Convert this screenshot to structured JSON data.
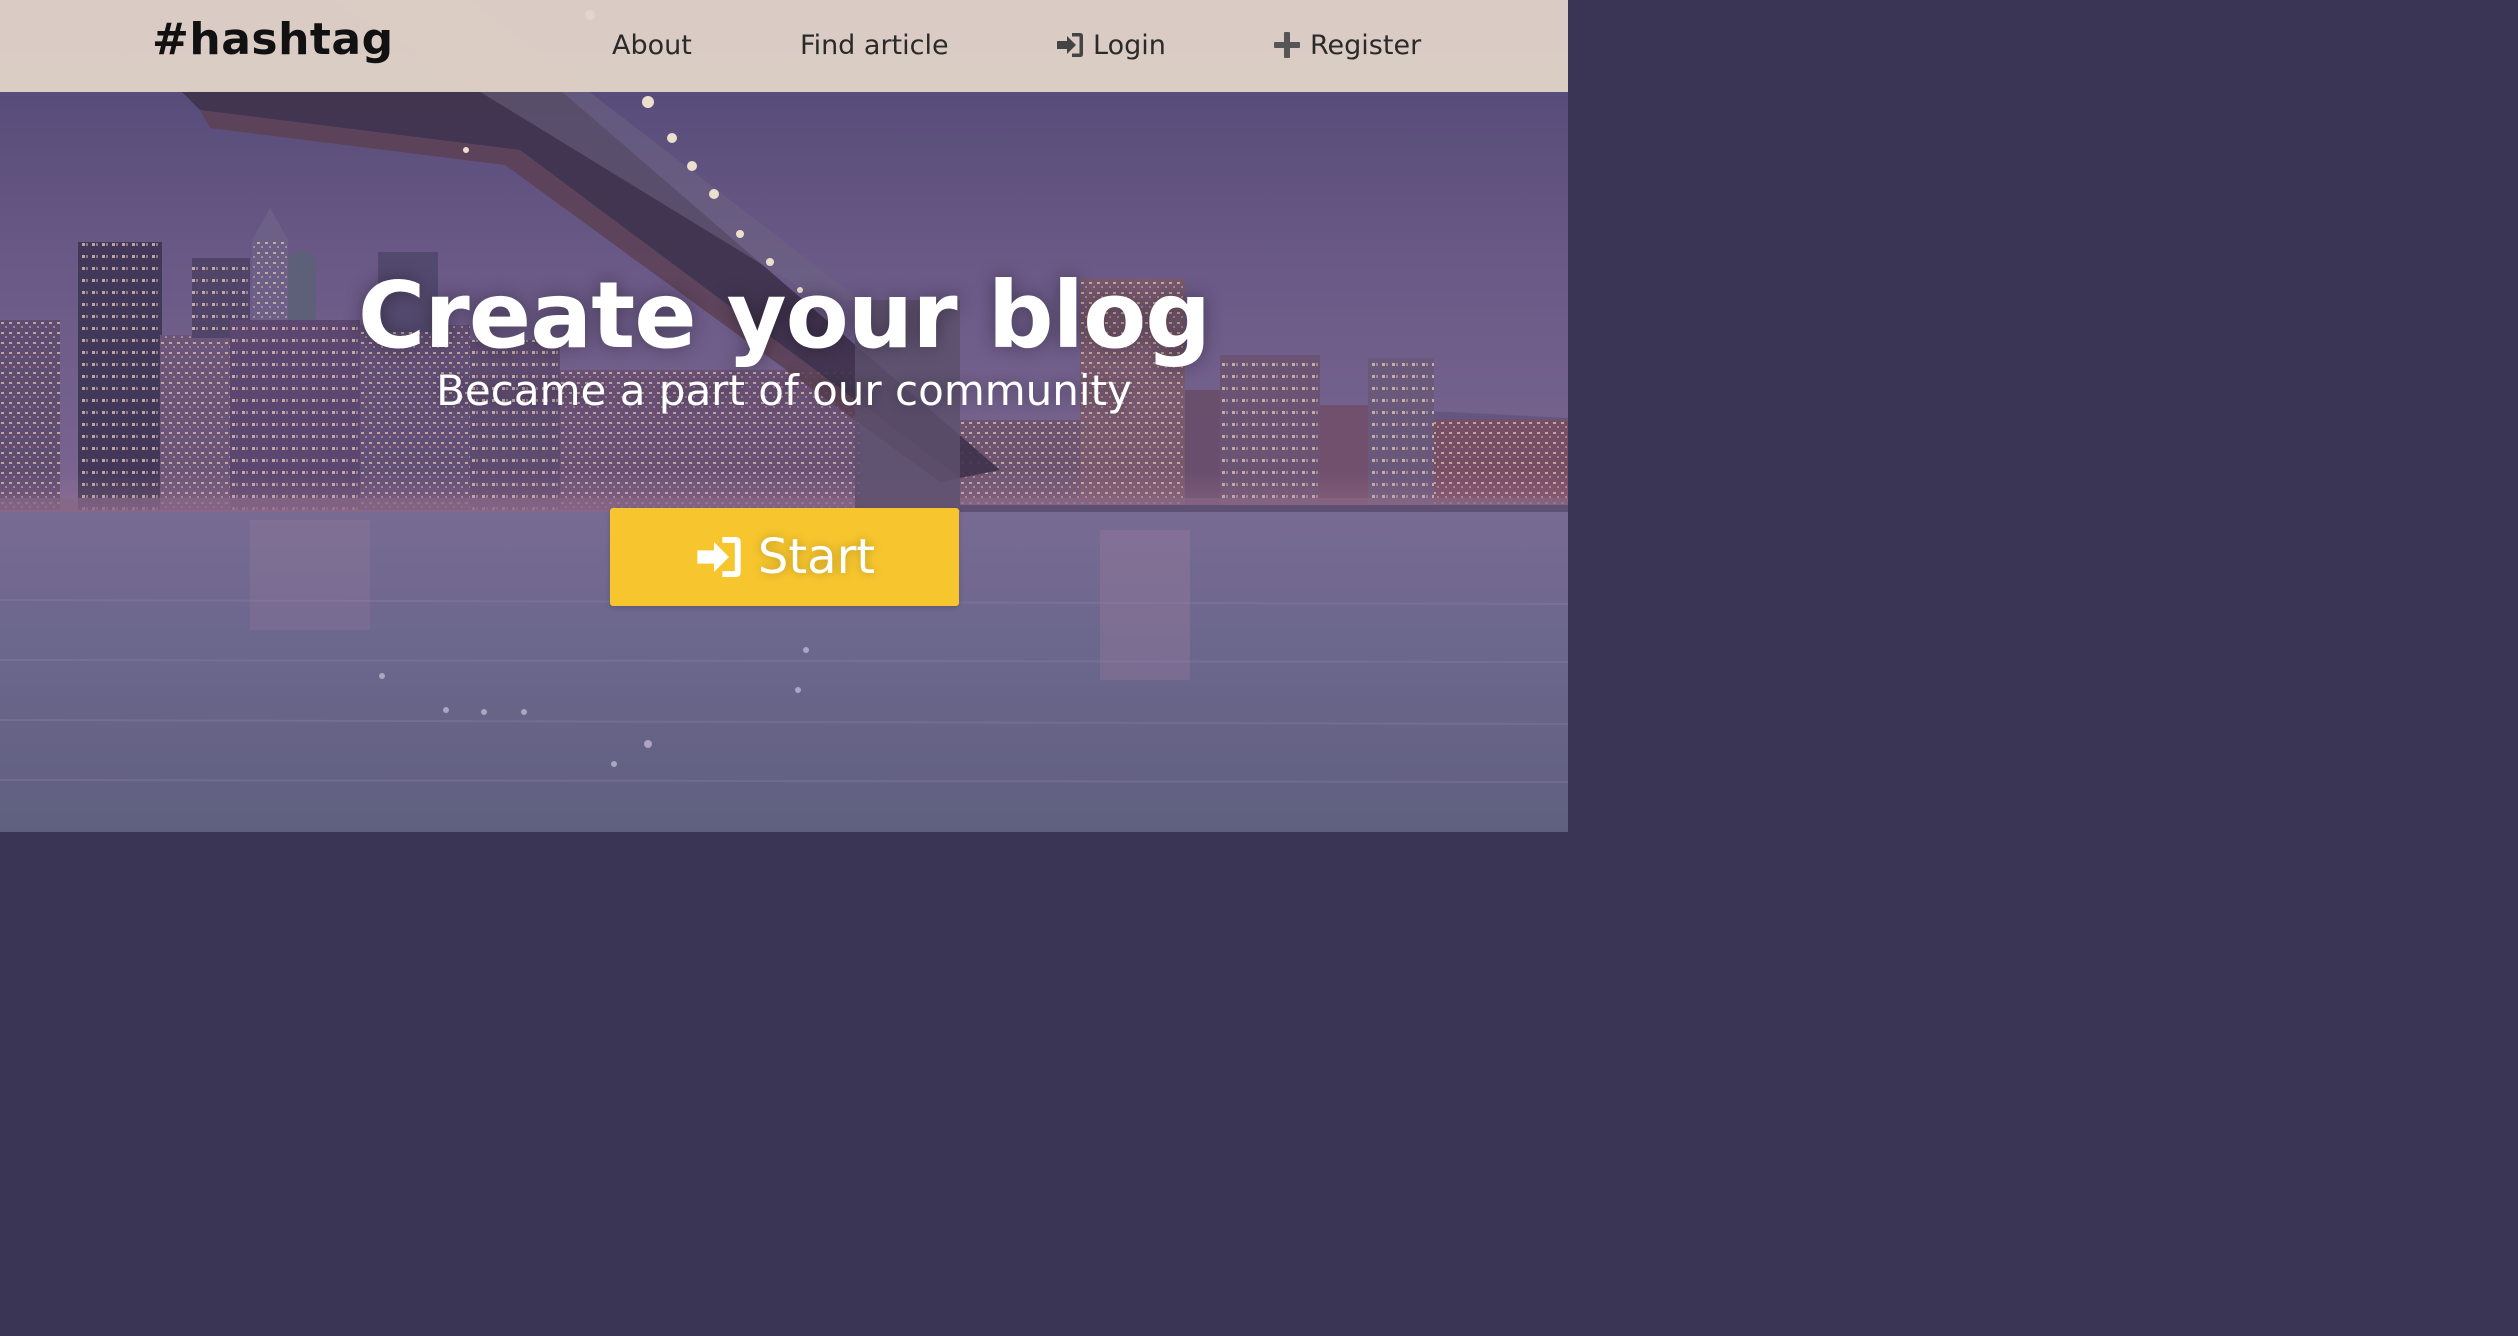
{
  "navbar": {
    "brand": "#hashtag",
    "links": [
      {
        "label": "About",
        "icon": ""
      },
      {
        "label": "Find article",
        "icon": ""
      },
      {
        "label": "Login",
        "icon": "sign-in-icon"
      },
      {
        "label": "Register",
        "icon": "plus-icon"
      }
    ]
  },
  "hero": {
    "title": "Create your blog",
    "subtitle": "Became a part of our community",
    "start_button": {
      "label": "Start",
      "icon": "sign-in-icon"
    }
  },
  "colors": {
    "navbar_bg": "#e2d4c8",
    "accent_button": "#f7c62e",
    "hero_text": "#ffffff"
  }
}
